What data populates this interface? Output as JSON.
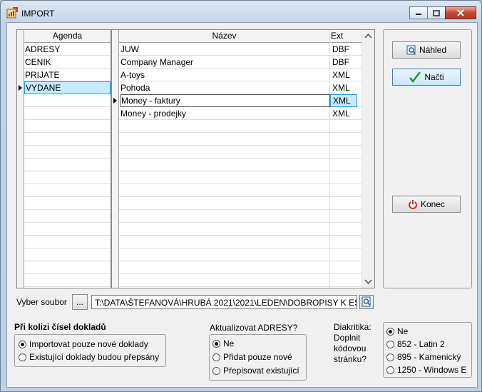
{
  "window": {
    "title": "IMPORT"
  },
  "agenda": {
    "header": "Agenda",
    "rows": [
      "ADRESY",
      "CENIK",
      "PRIJATE",
      "VYDANE"
    ],
    "selected_index": 3
  },
  "formats": {
    "headers": [
      "Název",
      "Ext"
    ],
    "rows": [
      {
        "name": "JUW",
        "ext": "DBF"
      },
      {
        "name": "Company Manager",
        "ext": "DBF"
      },
      {
        "name": "A-toys",
        "ext": "XML"
      },
      {
        "name": "Pohoda",
        "ext": "XML"
      },
      {
        "name": "Money - faktury",
        "ext": "XML"
      },
      {
        "name": "Money - prodejky",
        "ext": "XML"
      }
    ],
    "selected_index": 4
  },
  "buttons": {
    "preview": "Náhled",
    "load": "Načti",
    "exit": "Konec"
  },
  "file": {
    "label": "Vyber soubor",
    "browse": "...",
    "path": "T:\\DATA\\ŠTEFANOVÁ\\HRUBÁ 2021\\2021\\LEDEN\\DOBROPISY K ES"
  },
  "collision": {
    "title": "Při kolizi čísel dokladů",
    "options": [
      "Importovat pouze nové doklady",
      "Existující doklady budou přepsány"
    ],
    "selected": 0
  },
  "update_addresses": {
    "title": "Aktualizovat ADRESY?",
    "options": [
      "Ne",
      "Přidat pouze nové",
      "Přepisovat existující"
    ],
    "selected": 0
  },
  "diacritics": {
    "title": "Diakritika: Doplnit kódovou stránku?",
    "options": [
      "Ne",
      "852 - Latin 2",
      "895 - Kamenický",
      "1250 - Windows E"
    ],
    "selected": 0
  }
}
